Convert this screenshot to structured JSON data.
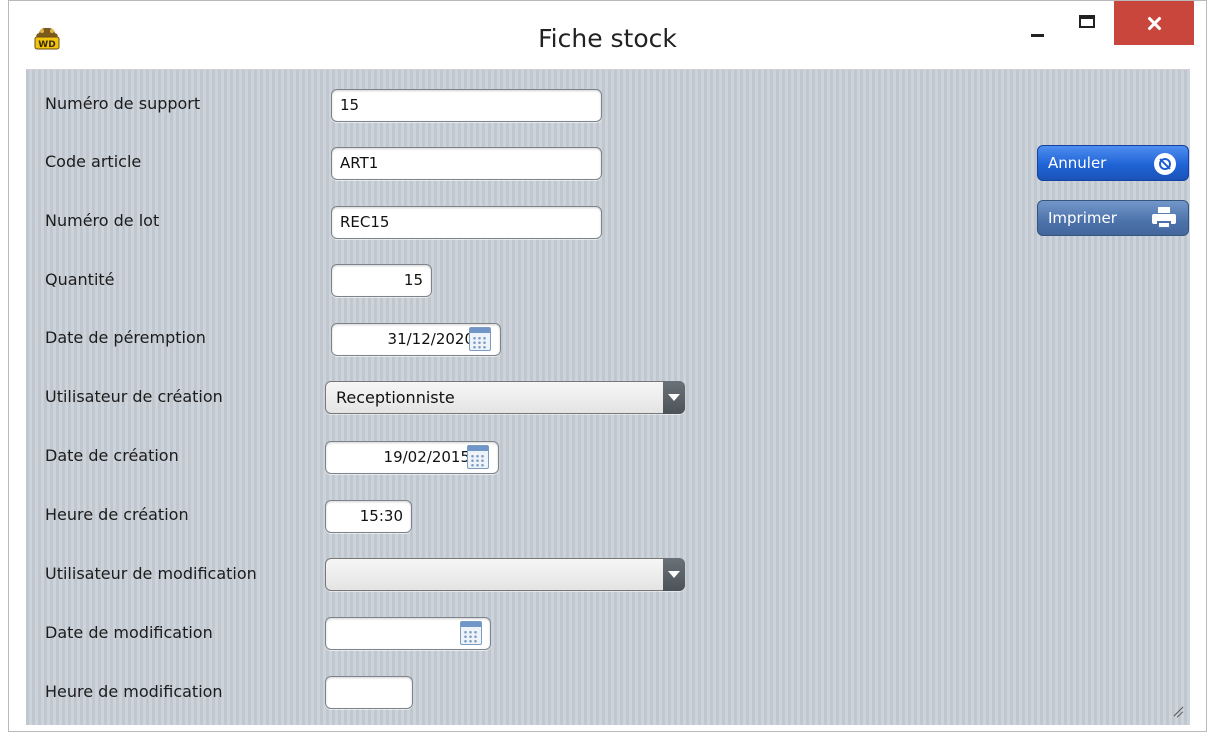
{
  "window": {
    "title": "Fiche stock",
    "app_icon": "windev-icon",
    "controls": [
      "minimize-icon",
      "maximize-icon",
      "close-icon"
    ]
  },
  "form": {
    "numero_support": {
      "label": "Numéro de support",
      "value": "15"
    },
    "code_article": {
      "label": "Code article",
      "value": "ART1"
    },
    "numero_lot": {
      "label": "Numéro de lot",
      "value": "REC15"
    },
    "quantite": {
      "label": "Quantité",
      "value": "15"
    },
    "date_peremption": {
      "label": "Date de péremption",
      "value": "31/12/2020"
    },
    "utilisateur_creation": {
      "label": "Utilisateur de création",
      "value": "Receptionniste"
    },
    "date_creation": {
      "label": "Date de création",
      "value": "19/02/2015"
    },
    "heure_creation": {
      "label": "Heure de création",
      "value": "15:30"
    },
    "utilisateur_modification": {
      "label": "Utilisateur de modification",
      "value": ""
    },
    "date_modification": {
      "label": "Date de modification",
      "value": ""
    },
    "heure_modification": {
      "label": "Heure de modification",
      "value": ""
    }
  },
  "actions": {
    "annuler": {
      "label": "Annuler",
      "icon": "cancel-icon",
      "color": "#1f63d6"
    },
    "imprimer": {
      "label": "Imprimer",
      "icon": "printer-icon",
      "color": "#4c72ab"
    }
  },
  "colors": {
    "background": "#c3cad2",
    "close_button": "#c9463d"
  }
}
